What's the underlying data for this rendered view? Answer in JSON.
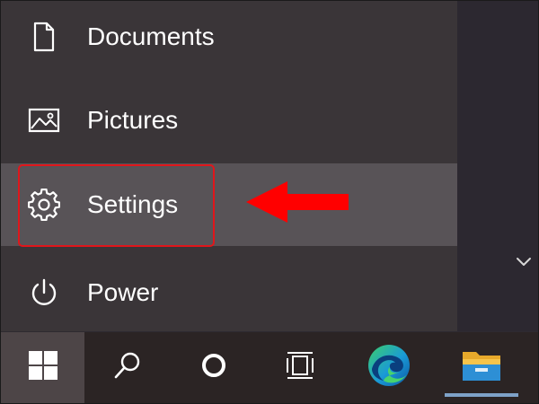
{
  "start_menu": {
    "items": [
      {
        "label": "Documents",
        "icon": "document-icon"
      },
      {
        "label": "Pictures",
        "icon": "pictures-icon"
      },
      {
        "label": "Settings",
        "icon": "gear-icon"
      },
      {
        "label": "Power",
        "icon": "power-icon"
      }
    ]
  },
  "annotation": {
    "highlight_color": "#e0161b",
    "arrow_color": "#ff0000"
  },
  "taskbar": {
    "buttons": [
      {
        "icon": "windows-logo-icon"
      },
      {
        "icon": "search-icon"
      },
      {
        "icon": "cortana-icon"
      },
      {
        "icon": "task-view-icon"
      },
      {
        "icon": "edge-icon"
      },
      {
        "icon": "file-explorer-icon"
      }
    ],
    "active_indicator_color": "#7ea2c8"
  }
}
